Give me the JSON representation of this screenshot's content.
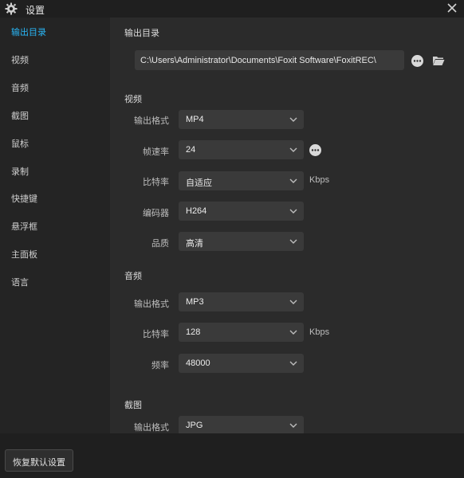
{
  "window": {
    "title": "设置"
  },
  "sidebar": {
    "items": [
      {
        "label": "输出目录",
        "active": true
      },
      {
        "label": "视频"
      },
      {
        "label": "音频"
      },
      {
        "label": "截图"
      },
      {
        "label": "鼠标"
      },
      {
        "label": "录制"
      },
      {
        "label": "快捷键"
      },
      {
        "label": "悬浮框"
      },
      {
        "label": "主面板"
      },
      {
        "label": "语言"
      }
    ]
  },
  "output": {
    "title": "输出目录",
    "path": "C:\\Users\\Administrator\\Documents\\Foxit Software\\FoxitREC\\"
  },
  "video": {
    "title": "视频",
    "format_label": "输出格式",
    "format_value": "MP4",
    "fps_label": "帧速率",
    "fps_value": "24",
    "bitrate_label": "比特率",
    "bitrate_value": "自适应",
    "bitrate_unit": "Kbps",
    "encoder_label": "编码器",
    "encoder_value": "H264",
    "quality_label": "品质",
    "quality_value": "高清"
  },
  "audio": {
    "title": "音频",
    "format_label": "输出格式",
    "format_value": "MP3",
    "bitrate_label": "比特率",
    "bitrate_value": "128",
    "bitrate_unit": "Kbps",
    "freq_label": "频率",
    "freq_value": "48000"
  },
  "screenshot": {
    "title": "截图",
    "format_label": "输出格式",
    "format_value": "JPG"
  },
  "footer": {
    "reset_label": "恢复默认设置"
  },
  "colors": {
    "accent": "#29b6f6",
    "background": "#2b2b2b",
    "sidebar": "#242424"
  }
}
